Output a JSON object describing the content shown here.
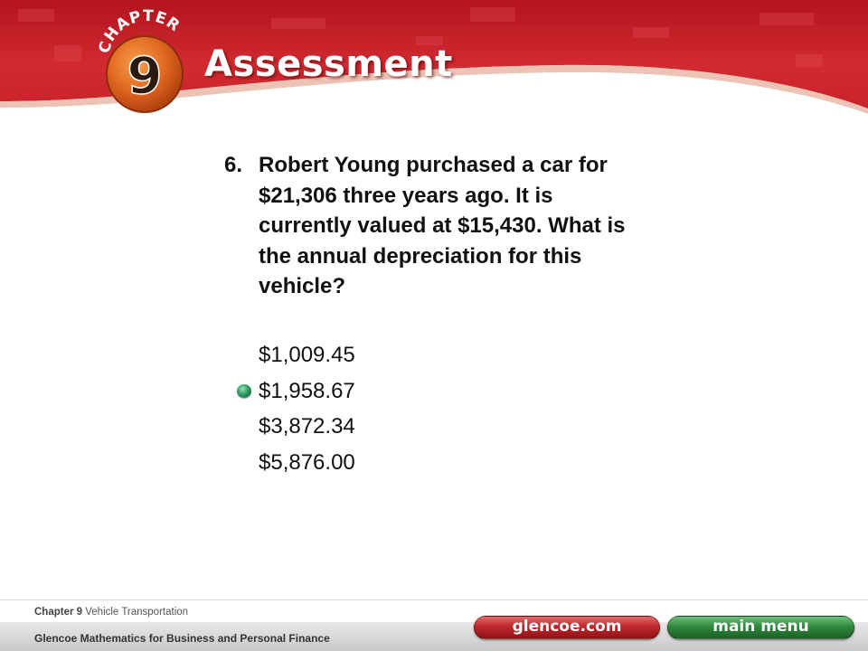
{
  "header": {
    "chapter_label": "CHAPTER",
    "chapter_number": "9",
    "title": "Assessment"
  },
  "question": {
    "number": "6.",
    "text": "Robert Young purchased a car for $21,306 three years ago. It is currently valued at $15,430. What is the annual depreciation for this vehicle?",
    "answers": [
      {
        "label": "$1,009.45",
        "correct": false
      },
      {
        "label": "$1,958.67",
        "correct": true
      },
      {
        "label": "$3,872.34",
        "correct": false
      },
      {
        "label": "$5,876.00",
        "correct": false
      }
    ]
  },
  "footer": {
    "chapter_ref": "Chapter 9",
    "chapter_topic": "Vehicle Transportation",
    "book_title": "Glencoe Mathematics for Business and Personal Finance",
    "glencoe_button": "glencoe.com",
    "main_menu_button": "main menu"
  },
  "colors": {
    "banner_red": "#c8202a",
    "badge_orange": "#e0661f",
    "correct_marker": "#2a9d63"
  }
}
